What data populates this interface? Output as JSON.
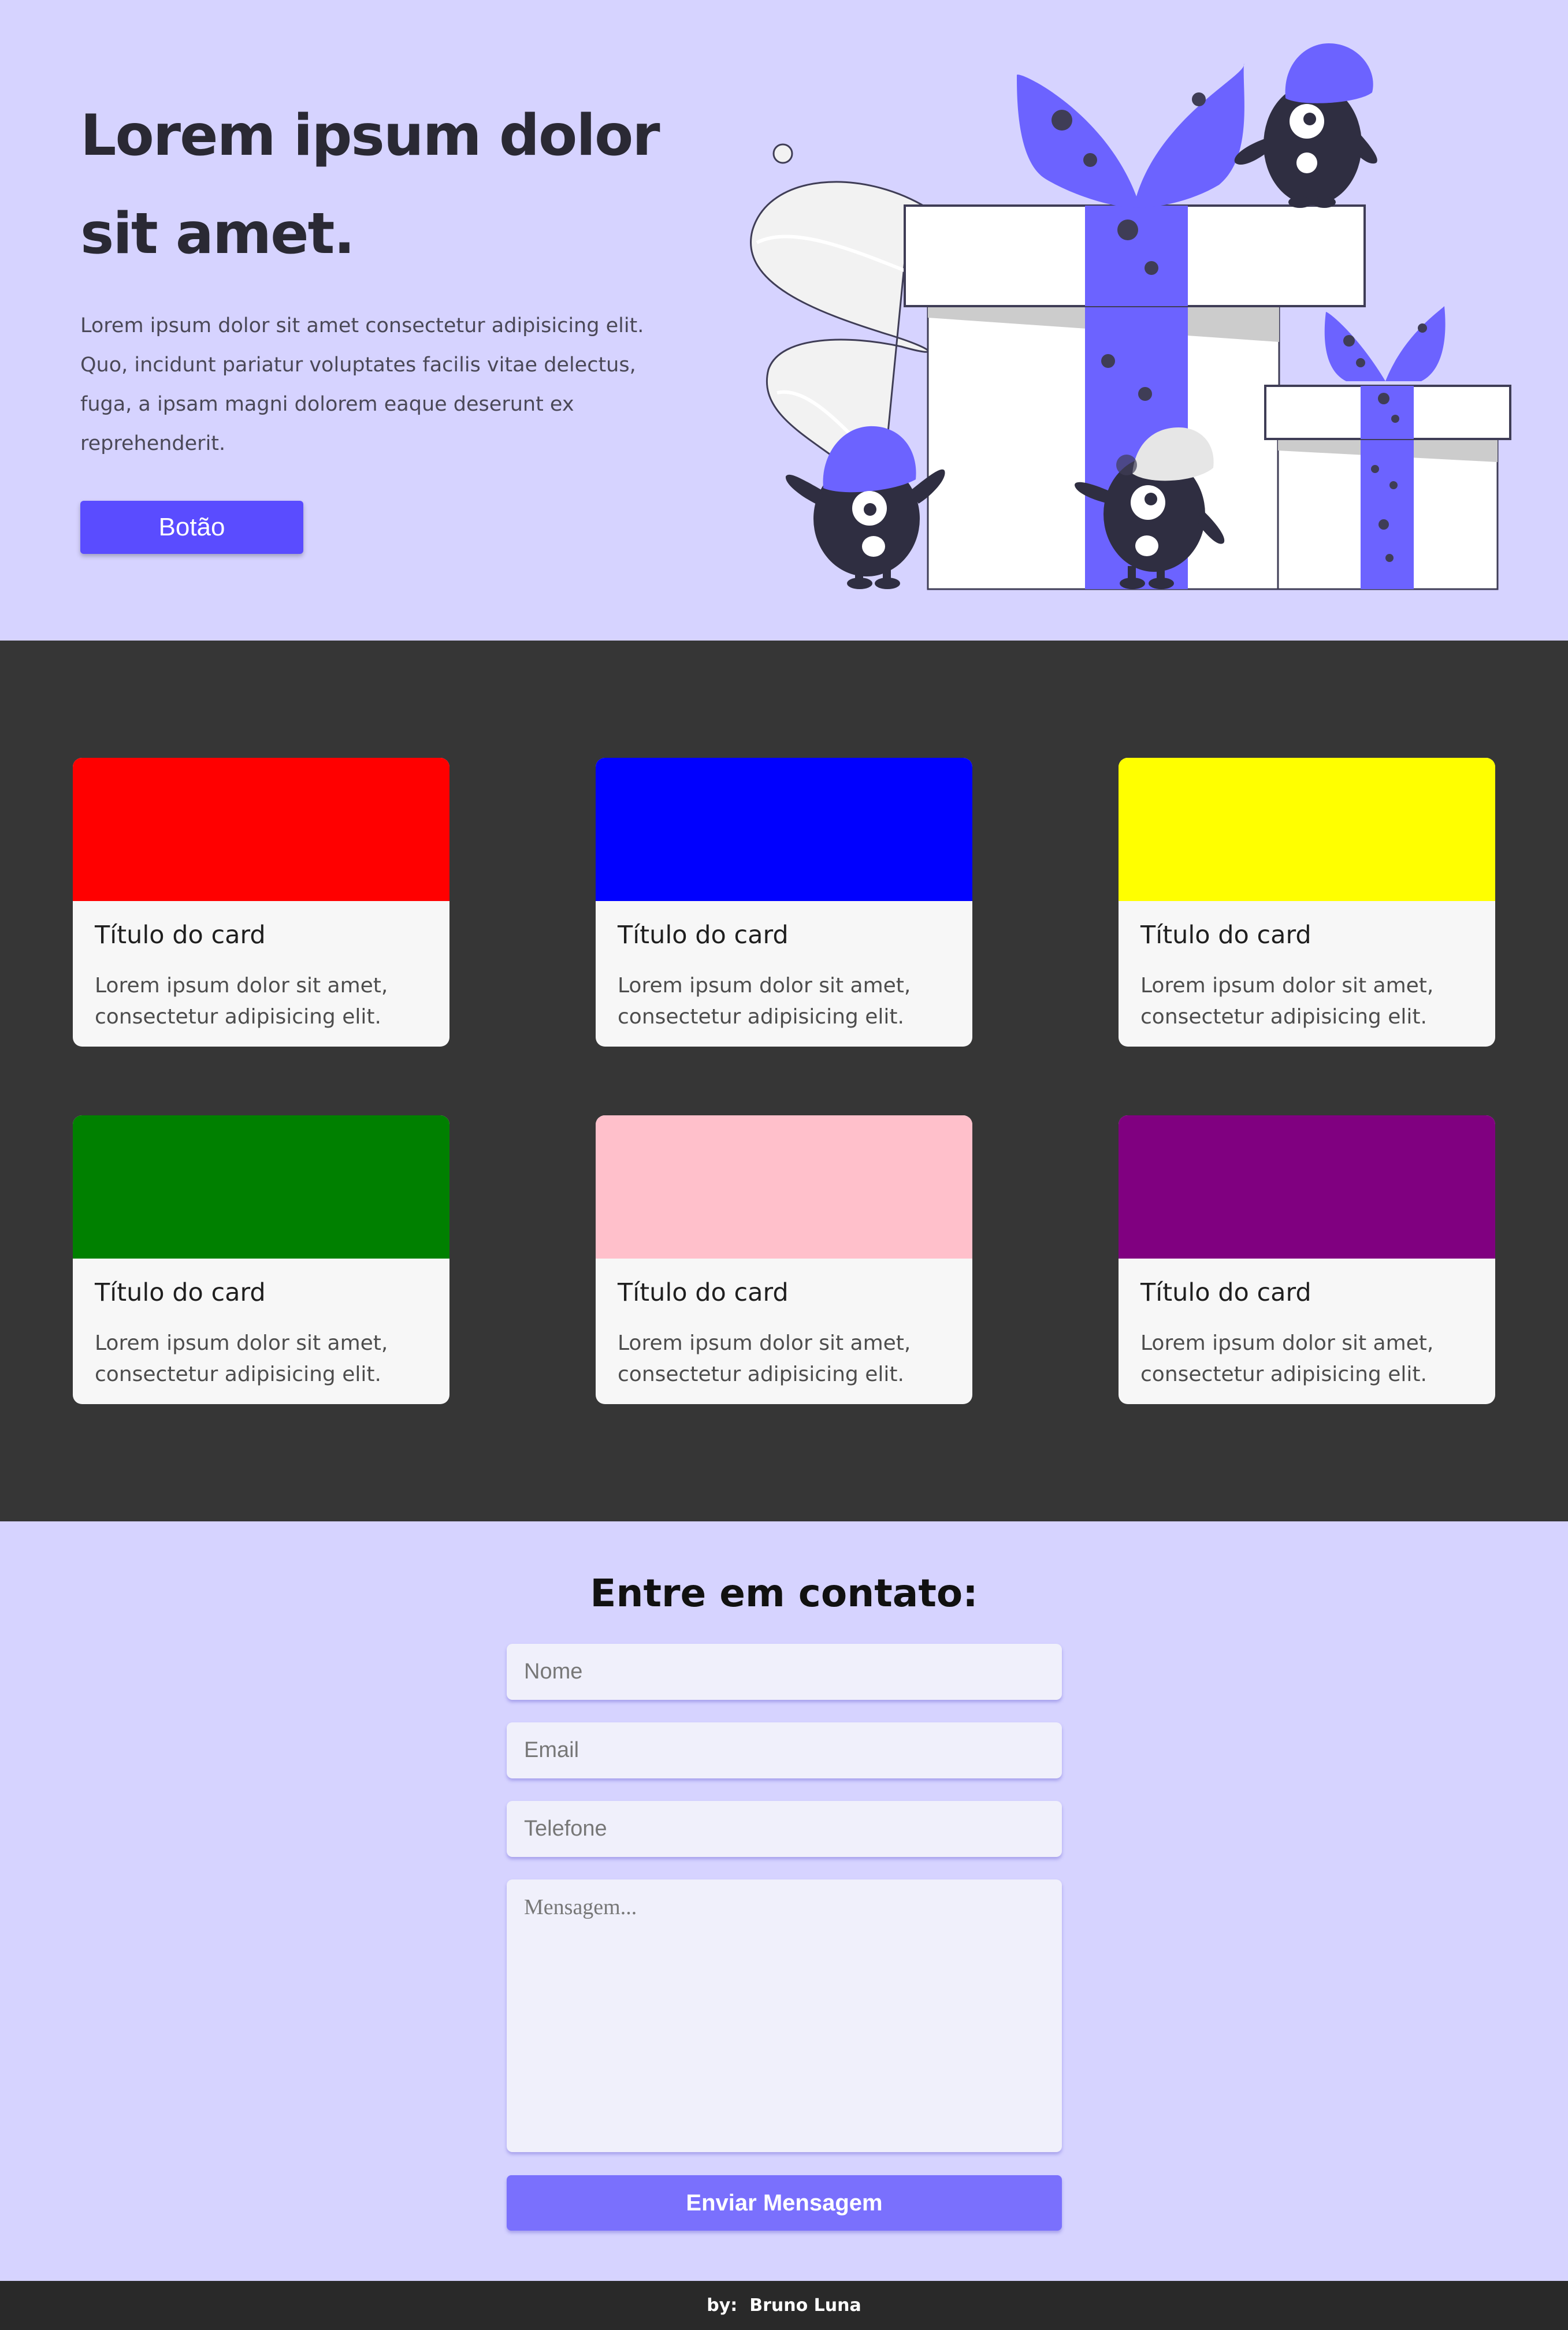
{
  "hero": {
    "title": "Lorem ipsum dolor sit amet.",
    "text": "Lorem ipsum dolor sit amet consectetur adipisicing elit. Quo, incidunt pariatur voluptates facilis vitae delectus, fuga, a ipsam magni dolorem eaque deserunt ex reprehenderit.",
    "button_label": "Botão"
  },
  "cards": [
    {
      "title": "Título do card",
      "text": "Lorem ipsum dolor sit amet, consectetur adipisicing elit.",
      "color": "#ff0000"
    },
    {
      "title": "Título do card",
      "text": "Lorem ipsum dolor sit amet, consectetur adipisicing elit.",
      "color": "#0000ff"
    },
    {
      "title": "Título do card",
      "text": "Lorem ipsum dolor sit amet, consectetur adipisicing elit.",
      "color": "#ffff00"
    },
    {
      "title": "Título do card",
      "text": "Lorem ipsum dolor sit amet, consectetur adipisicing elit.",
      "color": "#008000"
    },
    {
      "title": "Título do card",
      "text": "Lorem ipsum dolor sit amet, consectetur adipisicing elit.",
      "color": "#ffc0cb"
    },
    {
      "title": "Título do card",
      "text": "Lorem ipsum dolor sit amet, consectetur adipisicing elit.",
      "color": "#800080"
    }
  ],
  "contact": {
    "title": "Entre em contato:",
    "name_placeholder": "Nome",
    "email_placeholder": "Email",
    "phone_placeholder": "Telefone",
    "message_placeholder": "Mensagem...",
    "send_label": "Enviar Mensagem"
  },
  "footer": {
    "text": "by:  Bruno Luna"
  },
  "colors": {
    "page_bg": "#d6d3ff",
    "dark_bg": "#363636",
    "accent": "#5a4cff",
    "send_button": "#7a70fd",
    "illustration_accent": "#6c63ff",
    "footer_bg": "#292929"
  },
  "icons": {
    "illustration": "gift-boxes-monsters-illustration"
  }
}
